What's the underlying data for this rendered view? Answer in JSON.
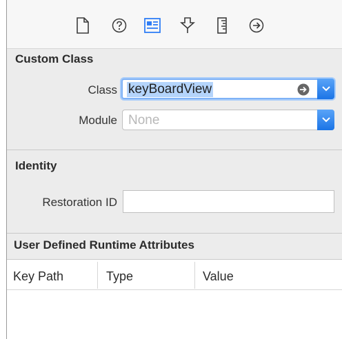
{
  "toolbar": {
    "icons": [
      "file-inspector-icon",
      "quick-help-icon",
      "identity-inspector-icon",
      "attributes-inspector-icon",
      "size-inspector-icon",
      "connections-inspector-icon"
    ]
  },
  "custom_class": {
    "title": "Custom Class",
    "class_label": "Class",
    "class_value": "keyBoardView",
    "module_label": "Module",
    "module_placeholder": "None"
  },
  "identity": {
    "title": "Identity",
    "restoration_id_label": "Restoration ID",
    "restoration_id_value": ""
  },
  "runtime_attributes": {
    "title": "User Defined Runtime Attributes",
    "columns": [
      "Key Path",
      "Type",
      "Value"
    ]
  },
  "colors": {
    "accent": "#2f7df6",
    "selection": "#b4d4fb",
    "panel": "#ececec"
  }
}
